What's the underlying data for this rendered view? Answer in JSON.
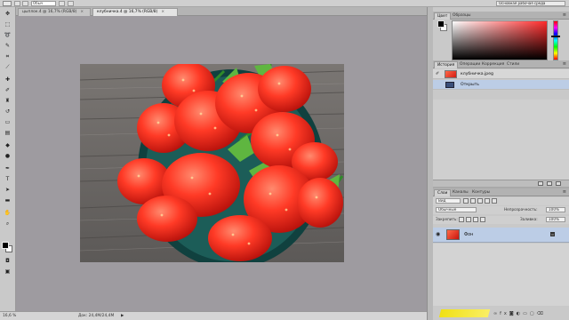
{
  "options_bar": {
    "brush_mode": "Обыч",
    "workspace": "Основная рабочая среда"
  },
  "doc_tabs": [
    {
      "label": "цыплок.4 @ 16,7% (RGB/8)",
      "active": false
    },
    {
      "label": "клубничка.4 @ 16,7% (RGB/8)",
      "active": true
    }
  ],
  "status": {
    "zoom": "16,6 %",
    "doc_info": "Док: 24,4M/24,4M"
  },
  "color_panel": {
    "tabs": [
      "Цвет",
      "Образцы"
    ],
    "foreground": "#000000",
    "background": "#ffffff"
  },
  "history_panel": {
    "tabs": [
      "История",
      "Операции",
      "Коррекция",
      "Стили"
    ],
    "snapshot_label": "клубничка.jpeg",
    "items": [
      {
        "label": "Открыть",
        "selected": true
      }
    ]
  },
  "layers_panel": {
    "tabs": [
      "Слои",
      "Каналы",
      "Контуры"
    ],
    "kind_filter": "Вид",
    "blend_mode": "Обычные",
    "opacity_label": "Непрозрачность:",
    "opacity_value": "100%",
    "lock_label": "Закрепить:",
    "fill_label": "Заливка:",
    "fill_value": "100%",
    "layers": [
      {
        "name": "Фон",
        "visible": true,
        "locked": true
      }
    ]
  },
  "icons": {
    "tools": [
      "move-icon",
      "marquee-icon",
      "lasso-icon",
      "quick-select-icon",
      "crop-icon",
      "eyedropper-icon",
      "healing-icon",
      "brush-icon",
      "stamp-icon",
      "history-brush-icon",
      "eraser-icon",
      "gradient-icon",
      "blur-icon",
      "dodge-icon",
      "pen-icon",
      "type-icon",
      "path-select-icon",
      "shape-icon",
      "hand-icon",
      "zoom-icon"
    ]
  }
}
